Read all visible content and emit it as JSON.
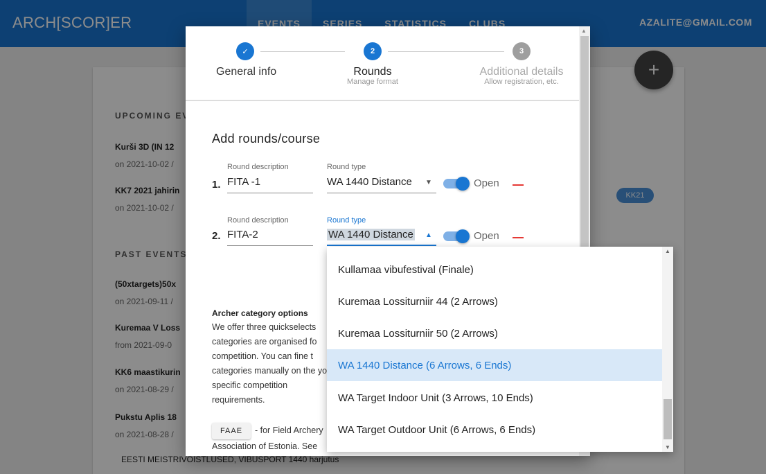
{
  "app": {
    "brand": "ARCH[SCOR]ER",
    "account": "AZALITE@GMAIL.COM"
  },
  "nav": {
    "items": [
      "EVENTS",
      "SERIES",
      "STATISTICS",
      "CLUBS"
    ]
  },
  "fab_label": "+",
  "background": {
    "upcoming_title": "UPCOMING EV",
    "events_upcoming": [
      {
        "title": "Kurši 3D (IN 12",
        "date": "on 2021-10-02 /"
      },
      {
        "title": "KK7 2021 jahirin",
        "date": "on 2021-10-02 /"
      }
    ],
    "past_title": "PAST EVENTS",
    "events_past": [
      {
        "title": "(50xtargets)50x",
        "date": "on 2021-09-11 /"
      },
      {
        "title": "Kuremaa V Loss",
        "date": "from 2021-09-0"
      },
      {
        "title": "KK6 maastikurin",
        "date": "on 2021-08-29 /"
      },
      {
        "title": "Pukstu Aplis 18",
        "date": "on 2021-08-28 /"
      }
    ],
    "bottom_line": "EESTI MEISTRIVÕISTLUSED, VIBUSPORT 1440 harjutus",
    "chip": "KK21"
  },
  "stepper": {
    "steps": [
      {
        "number": "1",
        "label": "General info",
        "sub": "",
        "state": "done"
      },
      {
        "number": "2",
        "label": "Rounds",
        "sub": "Manage format",
        "state": "active"
      },
      {
        "number": "3",
        "label": "Additional details",
        "sub": "Allow registration, etc.",
        "state": "pending"
      }
    ],
    "check_icon": "✓"
  },
  "form": {
    "title": "Add rounds/course",
    "round_desc_label": "Round description",
    "round_type_label": "Round type",
    "toggle_label": "Open",
    "rounds": [
      {
        "number": "1.",
        "description": "FITA -1",
        "type": "WA 1440 Distance",
        "open": true
      },
      {
        "number": "2.",
        "description": "FITA-2",
        "type": "WA 1440 Distance",
        "open": true
      }
    ]
  },
  "categories": {
    "title": "Archer category options",
    "text": "We offer three quickselects categories are organised fo competition. You can fine t categories manually on the your specific competition requirements.",
    "faae_label": "FAAE",
    "faae_text": "- for Field Archery",
    "faae_text2": "Association of Estonia. See"
  },
  "dropdown": {
    "options": [
      "Kullamaa vibufestival (Finale)",
      "Kuremaa Lossiturniir 44 (2 Arrows)",
      "Kuremaa Lossiturniir 50 (2 Arrows)",
      "WA 1440 Distance (6 Arrows, 6 Ends)",
      "WA Target Indoor Unit (3 Arrows, 10 Ends)",
      "WA Target Outdoor Unit (6 Arrows, 6 Ends)"
    ],
    "selected": "WA 1440 Distance (6 Arrows, 6 Ends)"
  }
}
